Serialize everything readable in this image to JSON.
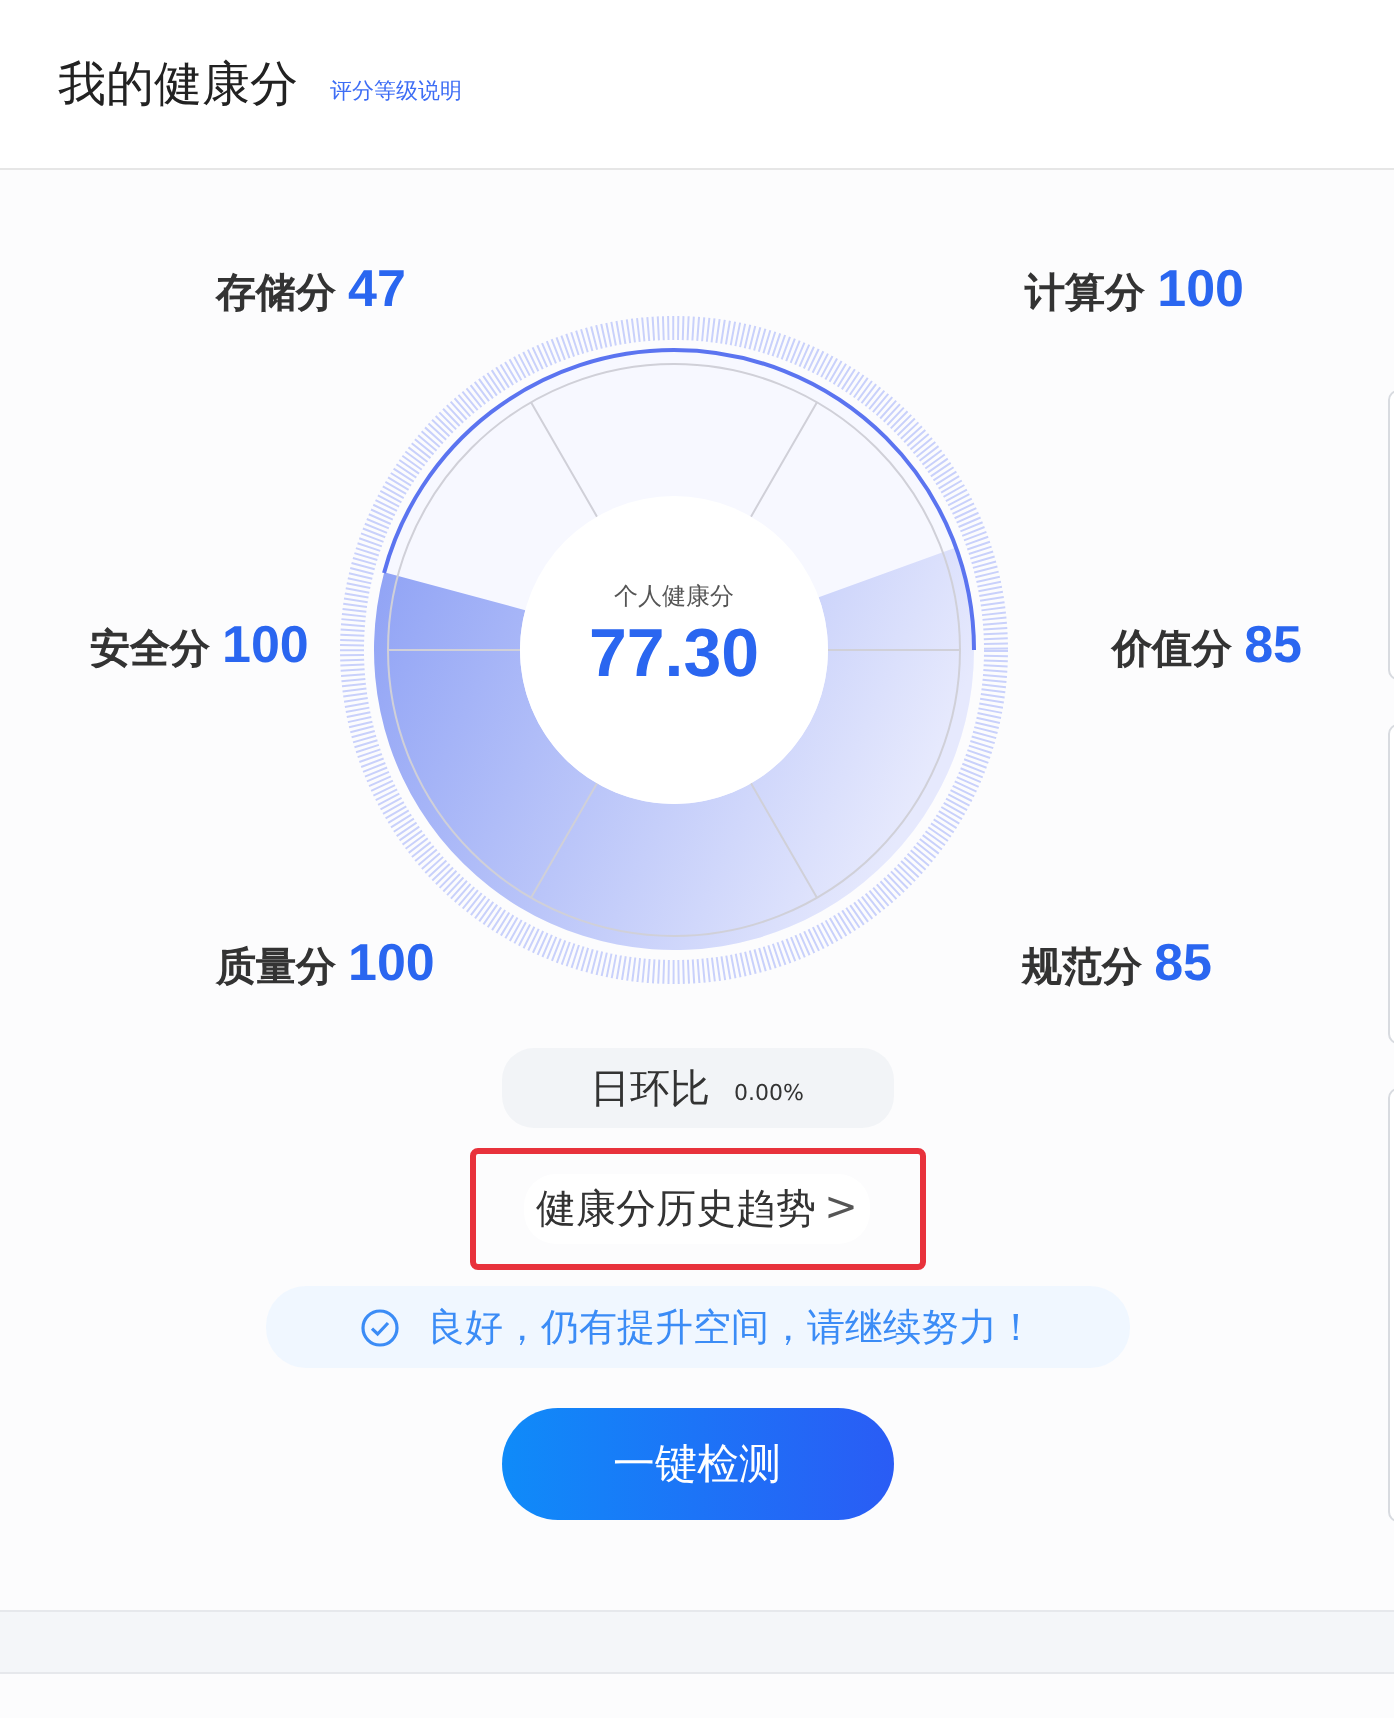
{
  "header": {
    "title": "我的健康分",
    "link": "评分等级说明"
  },
  "scores": [
    {
      "label": "存储分",
      "value": "47"
    },
    {
      "label": "计算分",
      "value": "100"
    },
    {
      "label": "安全分",
      "value": "100"
    },
    {
      "label": "价值分",
      "value": "85"
    },
    {
      "label": "质量分",
      "value": "100"
    },
    {
      "label": "规范分",
      "value": "85"
    }
  ],
  "gauge": {
    "caption": "个人健康分",
    "score": "77.30"
  },
  "daily_change": {
    "label": "日环比",
    "value": "0.00%"
  },
  "history_link": {
    "label": "健康分历史趋势",
    "arrow": ">",
    "highlighted": true
  },
  "status": {
    "message": "良好，仍有提升空间，请继续努力！"
  },
  "action_button": "一键检测"
}
